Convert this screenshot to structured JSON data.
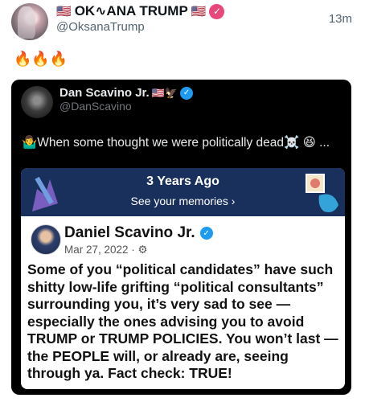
{
  "tweet": {
    "author_name": "OK∿ANA TRUMP",
    "author_flag": "🇺🇸",
    "author_handle": "@OksanaTrump",
    "timestamp": "13m",
    "text": "🔥🔥🔥"
  },
  "quote": {
    "author_name": "Dan Scavino Jr.",
    "author_emojis": "🇺🇸🦅",
    "author_handle": "@DanScavino",
    "text": "🤷‍♂️When some thought we were politically dead☠️ 😆 ...",
    "memory_card": {
      "header_title": "3 Years Ago",
      "header_link": "See your memories ›",
      "post_author": "Daniel Scavino Jr.",
      "post_meta": "Mar 27, 2022 · ⚙",
      "post_body": "Some of you “political candidates” have such shitty low-life grifting “political consultants” surrounding you, it’s very sad to see — especially the ones advising you to avoid TRUMP or TRUMP POLICIES. You won’t last — the PEOPLE will, or already are, seeing through ya. Fact check: TRUE!"
    }
  },
  "icons": {
    "verified_pink": "✓",
    "verified_blue": "✓"
  },
  "colors": {
    "verified_pink": "#e8477a",
    "verified_blue": "#1d9bf0",
    "card_header": "#19305c"
  }
}
